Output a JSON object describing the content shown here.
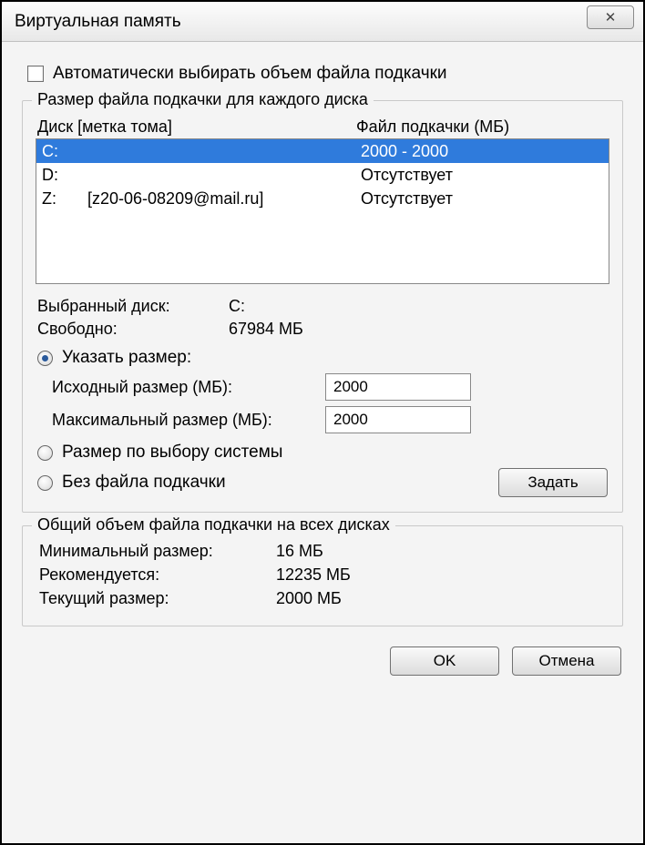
{
  "window": {
    "title": "Виртуальная память"
  },
  "auto": {
    "label": "Автоматически выбирать объем файла подкачки",
    "checked": false
  },
  "group1": {
    "legend": "Размер файла подкачки для каждого диска",
    "header_drive": "Диск [метка тома]",
    "header_pf": "Файл подкачки (МБ)",
    "rows": [
      {
        "drive": "C:",
        "label": "",
        "pf": "2000 - 2000",
        "selected": true
      },
      {
        "drive": "D:",
        "label": "",
        "pf": "Отсутствует",
        "selected": false
      },
      {
        "drive": "Z:",
        "label": "[z20-06-08209@mail.ru]",
        "pf": "Отсутствует",
        "selected": false
      }
    ],
    "selected_drive_lbl": "Выбранный диск:",
    "selected_drive_val": "C:",
    "free_lbl": "Свободно:",
    "free_val": "67984 МБ",
    "radio_custom": "Указать размер:",
    "initial_lbl": "Исходный размер (МБ):",
    "initial_val": "2000",
    "max_lbl": "Максимальный размер (МБ):",
    "max_val": "2000",
    "radio_system": "Размер по выбору системы",
    "radio_none": "Без файла подкачки",
    "set_btn": "Задать"
  },
  "group2": {
    "legend": "Общий объем файла подкачки на всех дисках",
    "min_lbl": "Минимальный размер:",
    "min_val": "16 МБ",
    "rec_lbl": "Рекомендуется:",
    "rec_val": "12235 МБ",
    "cur_lbl": "Текущий размер:",
    "cur_val": "2000 МБ"
  },
  "footer": {
    "ok": "OK",
    "cancel": "Отмена"
  }
}
